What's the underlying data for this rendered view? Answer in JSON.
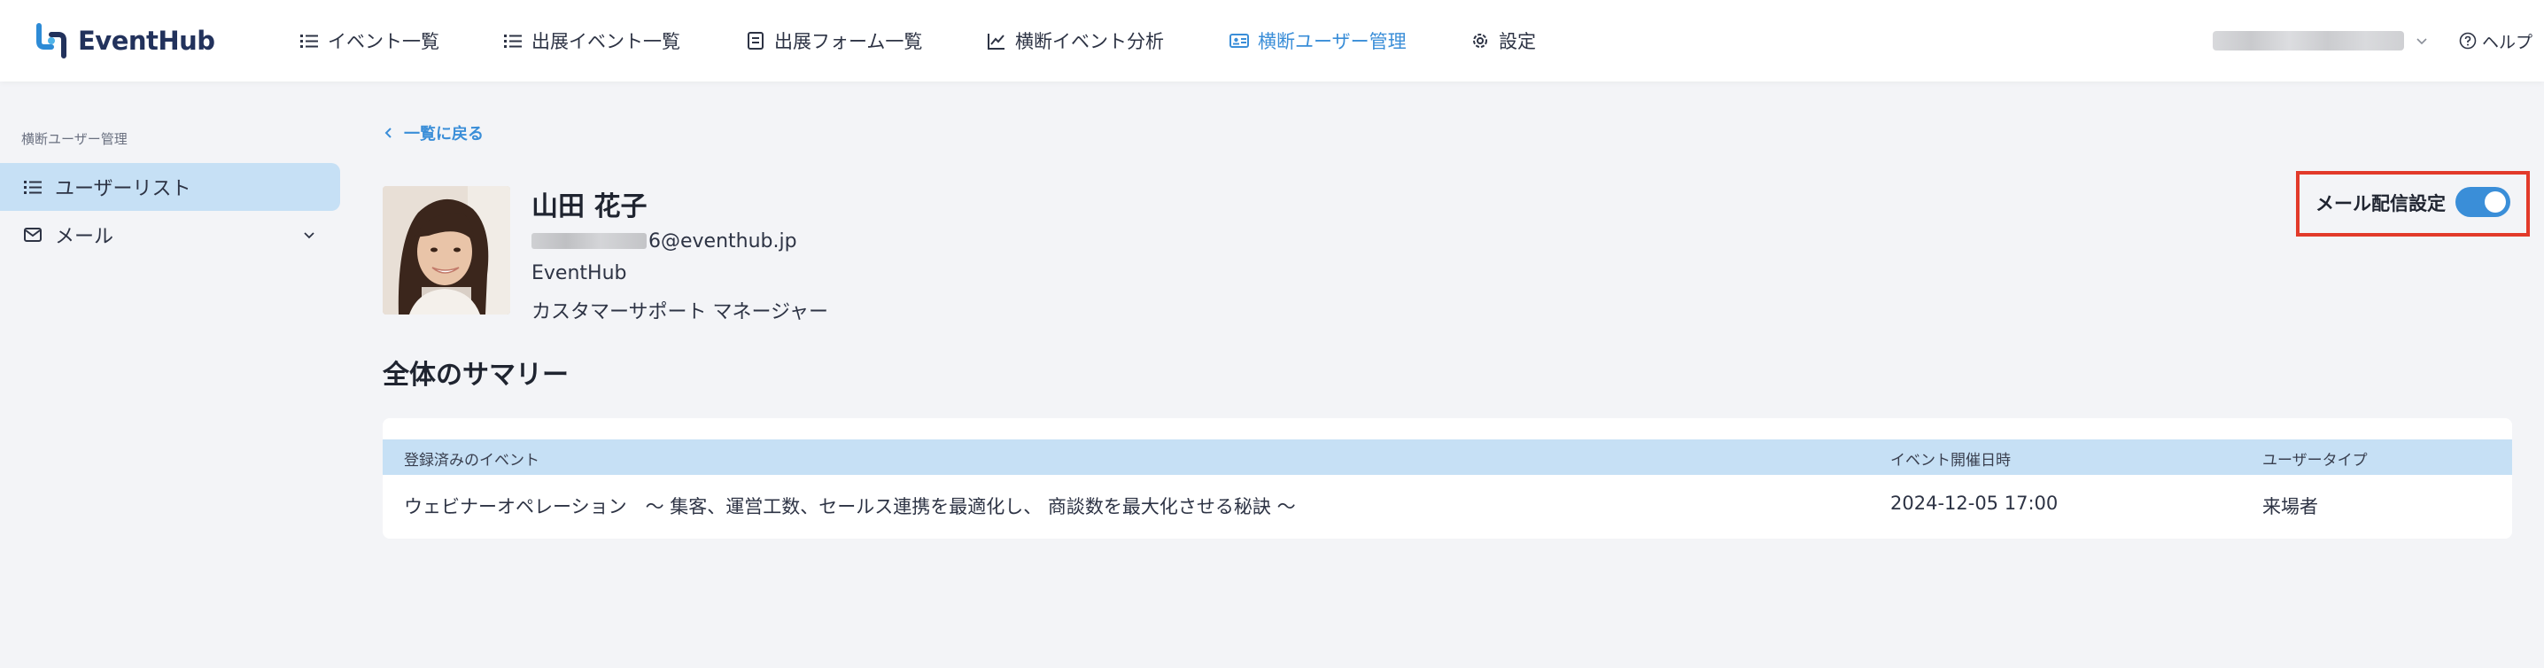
{
  "app": {
    "name": "EventHub"
  },
  "nav": {
    "items": [
      {
        "label": "イベント一覧",
        "icon": "list-icon"
      },
      {
        "label": "出展イベント一覧",
        "icon": "list-icon"
      },
      {
        "label": "出展フォーム一覧",
        "icon": "form-icon"
      },
      {
        "label": "横断イベント分析",
        "icon": "chart-line-icon"
      },
      {
        "label": "横断ユーザー管理",
        "icon": "user-card-icon",
        "active": true
      },
      {
        "label": "設定",
        "icon": "gear-icon"
      }
    ],
    "help_label": "ヘルプ"
  },
  "sidebar": {
    "section_label": "横断ユーザー管理",
    "items": [
      {
        "label": "ユーザーリスト",
        "icon": "list-icon",
        "active": true
      },
      {
        "label": "メール",
        "icon": "mail-icon"
      }
    ]
  },
  "main": {
    "back_label": "一覧に戻る",
    "user": {
      "name": "山田 花子",
      "email_suffix": "6@eventhub.jp",
      "company": "EventHub",
      "title": "カスタマーサポート マネージャー"
    },
    "mail_setting": {
      "label": "メール配信設定",
      "enabled": true
    },
    "summary_title": "全体のサマリー",
    "table": {
      "headers": [
        "登録済みのイベント",
        "イベント開催日時",
        "ユーザータイプ"
      ],
      "rows": [
        [
          "ウェビナーオペレーション　〜 集客、運営工数、セールス連携を最適化し、 商談数を最大化させる秘訣 〜",
          "2024-12-05 17:00",
          "来場者"
        ]
      ]
    }
  },
  "colors": {
    "accent": "#3a8ed8",
    "sidebar_active": "#c6e0f5",
    "highlight_box": "#e23a2a",
    "logo_primary": "#22325c"
  }
}
